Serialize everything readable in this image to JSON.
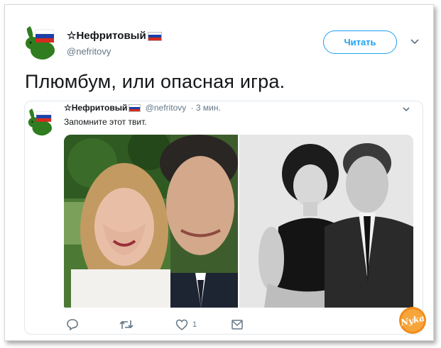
{
  "tweet": {
    "author_name": "☆Нефритовый",
    "author_handle": "@nefritovy",
    "follow_label": "Читать",
    "text": "Плюмбум, или опасная игра."
  },
  "quoted_tweet": {
    "author_name": "☆Нефритовый",
    "author_handle": "@nefritovy",
    "time": "· 3 мин.",
    "text": "Запомните этот твит.",
    "actions": {
      "reply_icon": "reply-icon",
      "retweet_icon": "retweet-icon",
      "like_icon": "heart-icon",
      "like_count": "1",
      "dm_icon": "envelope-icon"
    }
  },
  "watermark": {
    "text": "Nyka"
  },
  "colors": {
    "accent": "#1da1f2",
    "text": "#14171a",
    "muted": "#657786",
    "flag_white": "#ffffff",
    "flag_blue": "#1c3fa8",
    "flag_red": "#d52b1e",
    "avatar_green": "#2f7d1f",
    "logo_orange": "#f28c1a"
  }
}
